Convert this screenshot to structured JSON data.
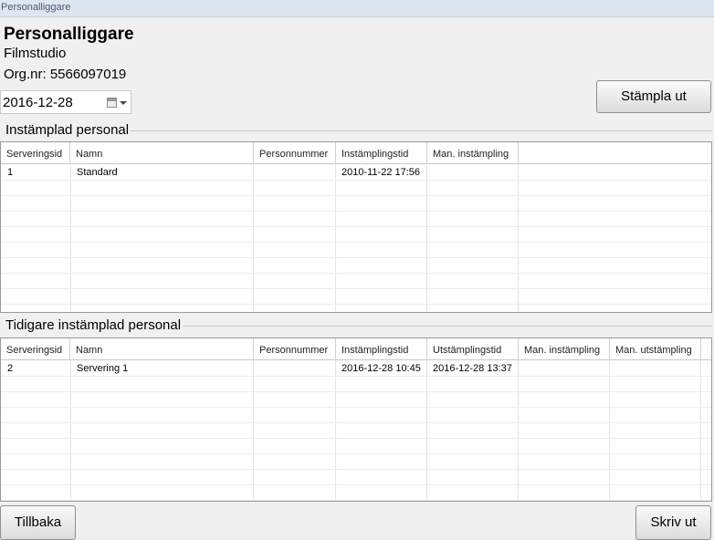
{
  "window": {
    "title": "Personalliggare"
  },
  "header": {
    "title": "Personalliggare",
    "company": "Filmstudio",
    "org_nr": "Org.nr: 5566097019"
  },
  "date_picker": {
    "value": "2016-12-28",
    "icon": "calendar-icon"
  },
  "buttons": {
    "stampla_ut": "Stämpla ut",
    "tillbaka": "Tillbaka",
    "skriv_ut": "Skriv ut"
  },
  "checked_in": {
    "title": "Instämplad personal",
    "columns": [
      "Serveringsid",
      "Namn",
      "Personnummer",
      "Instämplingstid",
      "Man. instämpling"
    ],
    "rows": [
      [
        "1",
        "Standard",
        "",
        "2010-11-22 17:56",
        ""
      ]
    ]
  },
  "checked_out": {
    "title": "Tidigare instämplad personal",
    "columns": [
      "Serveringsid",
      "Namn",
      "Personnummer",
      "Instämplingstid",
      "Utstämplingstid",
      "Man. instämpling",
      "Man. utstämpling"
    ],
    "rows": [
      [
        "2",
        "Servering 1",
        "",
        "2016-12-28 10:45",
        "2016-12-28 13:37",
        "",
        ""
      ]
    ]
  }
}
